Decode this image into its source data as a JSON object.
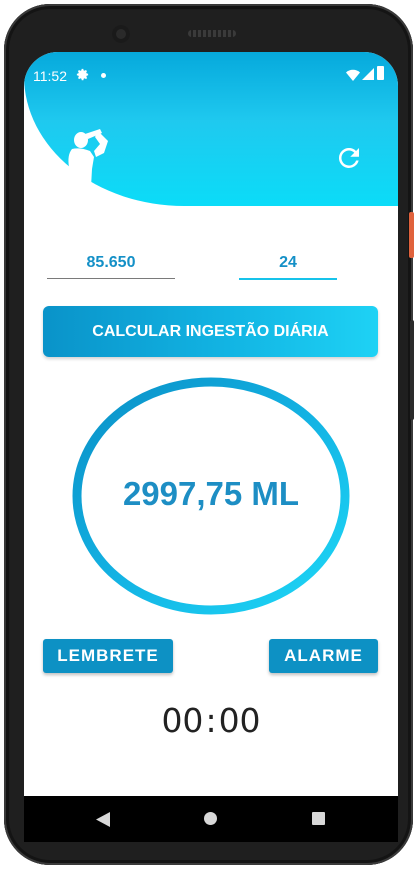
{
  "status_bar": {
    "time": "11:52",
    "icons": [
      "gear-icon",
      "dot-icon",
      "wifi-icon",
      "signal-icon",
      "battery-icon"
    ]
  },
  "header": {
    "illustration": "person-drinking-icon",
    "action_icon": "refresh-icon"
  },
  "inputs": {
    "weight": "85.650",
    "age": "24"
  },
  "calculate_button": {
    "label": "CALCULAR INGESTÃO DIÁRIA"
  },
  "result": {
    "value": "2997,75 ML"
  },
  "actions": {
    "reminder_label": "LEMBRETE",
    "alarm_label": "ALARME"
  },
  "timer": {
    "hours": "00",
    "separator": ":",
    "minutes": "00"
  },
  "navigation": [
    "back-icon",
    "home-icon",
    "recents-icon"
  ],
  "colors": {
    "primary": "#0d91c4",
    "accent": "#1ed2f5",
    "result_text": "#1d8ec4"
  }
}
